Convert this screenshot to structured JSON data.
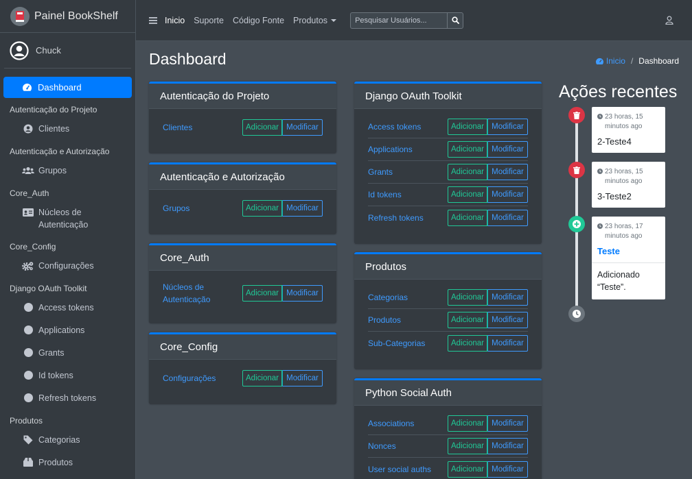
{
  "brand": {
    "title": "Painel BookShelf"
  },
  "user": {
    "name": "Chuck"
  },
  "sidebar": {
    "active": "Dashboard",
    "sections": [
      {
        "header": "Autenticação do Projeto",
        "items": [
          {
            "label": "Clientes",
            "icon": "user-circle-icon"
          }
        ]
      },
      {
        "header": "Autenticação e Autorização",
        "items": [
          {
            "label": "Grupos",
            "icon": "users-icon"
          }
        ]
      },
      {
        "header": "Core_Auth",
        "items": [
          {
            "label": "Núcleos de Autenticação",
            "icon": "id-card-icon"
          }
        ]
      },
      {
        "header": "Core_Config",
        "items": [
          {
            "label": "Configurações",
            "icon": "cogs-icon"
          }
        ]
      },
      {
        "header": "Django OAuth Toolkit",
        "items": [
          {
            "label": "Access tokens",
            "icon": "circle-icon"
          },
          {
            "label": "Applications",
            "icon": "circle-icon"
          },
          {
            "label": "Grants",
            "icon": "circle-icon"
          },
          {
            "label": "Id tokens",
            "icon": "circle-icon"
          },
          {
            "label": "Refresh tokens",
            "icon": "circle-icon"
          }
        ]
      },
      {
        "header": "Produtos",
        "items": [
          {
            "label": "Categorias",
            "icon": "tag-icon"
          },
          {
            "label": "Produtos",
            "icon": "box-icon"
          }
        ]
      }
    ]
  },
  "topbar": {
    "links": [
      "Inicio",
      "Suporte",
      "Código Fonte",
      "Produtos"
    ],
    "search_placeholder": "Pesquisar Usuários..."
  },
  "page": {
    "title": "Dashboard",
    "breadcrumb_home": "Inicio",
    "breadcrumb_current": "Dashboard"
  },
  "buttons": {
    "add": "Adicionar",
    "modify": "Modificar"
  },
  "cards": {
    "auth_projeto": {
      "title": "Autenticação do Projeto",
      "rows": [
        "Clientes"
      ]
    },
    "auth_autorizacao": {
      "title": "Autenticação e Autorização",
      "rows": [
        "Grupos"
      ]
    },
    "core_auth": {
      "title": "Core_Auth",
      "rows": [
        "Núcleos de Autenticação"
      ]
    },
    "core_config": {
      "title": "Core_Config",
      "rows": [
        "Configurações"
      ]
    },
    "oauth": {
      "title": "Django OAuth Toolkit",
      "rows": [
        "Access tokens",
        "Applications",
        "Grants",
        "Id tokens",
        "Refresh tokens"
      ]
    },
    "produtos": {
      "title": "Produtos",
      "rows": [
        "Categorias",
        "Produtos",
        "Sub-Categorias"
      ]
    },
    "social": {
      "title": "Python Social Auth",
      "rows": [
        "Associations",
        "Nonces",
        "User social auths"
      ]
    }
  },
  "recent": {
    "title": "Ações recentes",
    "items": [
      {
        "time": "23 horas, 15 minutos ago",
        "text": "2-Teste4",
        "type": "delete"
      },
      {
        "time": "23 horas, 15 minutos ago",
        "text": "3-Teste2",
        "type": "delete"
      },
      {
        "time": "23 horas, 17 minutos ago",
        "text": "Teste",
        "type": "add",
        "detail": "Adicionado “Teste”."
      }
    ]
  },
  "colors": {
    "accent": "#007bff",
    "sidebar": "#343a40",
    "content": "#454d55",
    "add": "#20c997",
    "danger": "#dc3545",
    "success": "#28a745"
  }
}
